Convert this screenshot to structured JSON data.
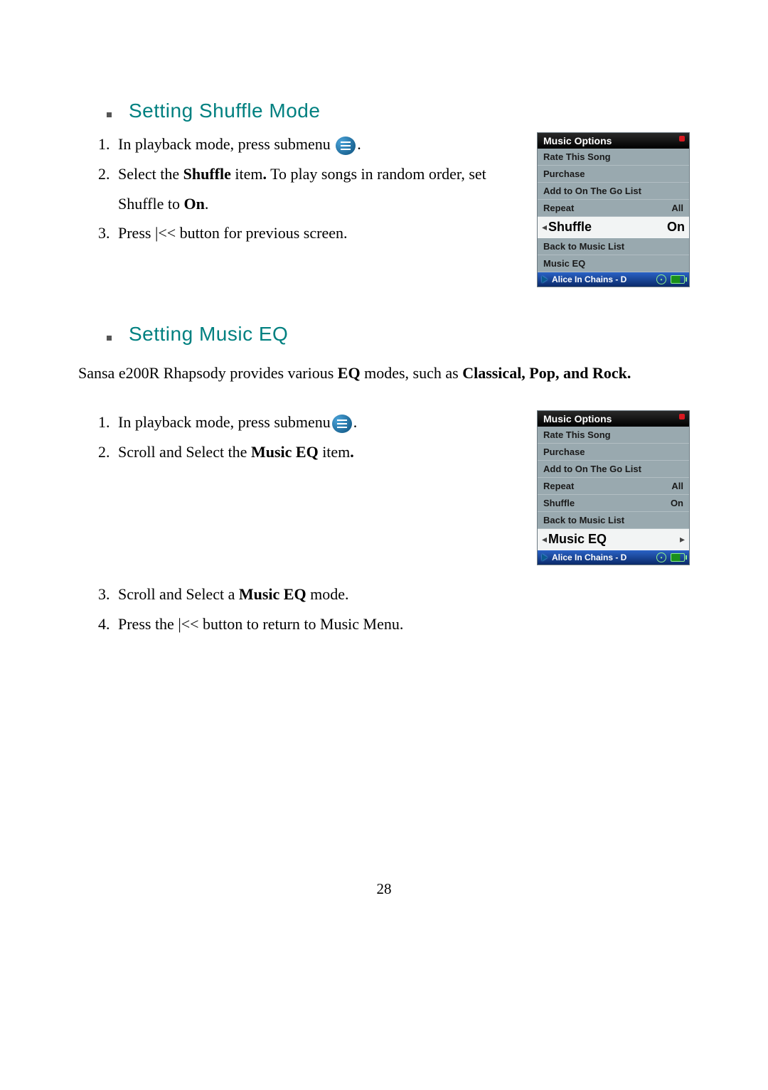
{
  "page_number": "28",
  "sections": [
    {
      "heading": "Setting Shuffle Mode",
      "steps": [
        {
          "pre": "In playback mode, press submenu",
          "post": "."
        },
        {
          "text": "Select the ",
          "bold1": "Shuffle",
          "mid": " item",
          "boldPunct": ".",
          "text2": " To play songs in random order, set Shuffle to ",
          "bold2": "On",
          "tail": "."
        },
        {
          "text": "Press |<< button for previous screen."
        }
      ]
    },
    {
      "heading": "Setting Music EQ",
      "intro_pre": "Sansa e200R Rhapsody provides various ",
      "intro_b1": "EQ",
      "intro_mid": " modes, such as ",
      "intro_b2": "Classical, Pop, and Rock.",
      "stepsA": [
        {
          "pre": "In playback mode, press submenu",
          "post": "."
        },
        {
          "text": "Scroll and Select the ",
          "bold1": "Music EQ",
          "mid": " item",
          "boldPunct": "."
        }
      ],
      "stepsB": [
        {
          "text": "Scroll and Select a ",
          "bold1": "Music EQ",
          "tail": " mode."
        },
        {
          "text": "Press the |<< button to return to Music Menu."
        }
      ]
    }
  ],
  "device1": {
    "title": "Music Options",
    "rows": [
      {
        "label": "Rate This Song",
        "value": ""
      },
      {
        "label": "Purchase",
        "value": ""
      },
      {
        "label": "Add to On The Go List",
        "value": ""
      },
      {
        "label": "Repeat",
        "value": "All"
      }
    ],
    "selected": {
      "label": "Shuffle",
      "value": "On"
    },
    "rows_after": [
      {
        "label": "Back to Music List",
        "value": ""
      },
      {
        "label": "Music EQ",
        "value": ""
      }
    ],
    "now_playing": "Alice In Chains - D"
  },
  "device2": {
    "title": "Music Options",
    "rows": [
      {
        "label": "Rate This Song",
        "value": ""
      },
      {
        "label": "Purchase",
        "value": ""
      },
      {
        "label": "Add to On The Go List",
        "value": ""
      },
      {
        "label": "Repeat",
        "value": "All"
      },
      {
        "label": "Shuffle",
        "value": "On"
      },
      {
        "label": "Back to Music List",
        "value": ""
      }
    ],
    "selected": {
      "label": "Music EQ",
      "value": ""
    },
    "rows_after": [],
    "now_playing": "Alice In Chains - D"
  }
}
